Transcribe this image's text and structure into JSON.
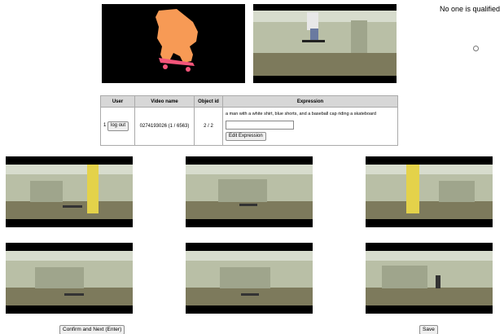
{
  "status": {
    "message": "No one is qualified"
  },
  "table": {
    "headers": [
      "User",
      "Video name",
      "Object id",
      "Expression"
    ],
    "user_index": "1",
    "logout_label": "log out",
    "video_name": "0274193026 (1 / 6563)",
    "object_id": "2 / 2",
    "expression": "a man with a white shirt, blue shorts, and a baseball cap riding a skateboard",
    "expression_input_value": "",
    "edit_expression_label": "Edit Expression"
  },
  "buttons": {
    "confirm_next": "Confirm and Next (Enter)",
    "save": "Save"
  },
  "colors": {
    "mask_fill": "#f79a55",
    "skateboard_fill": "#f5557a",
    "frame_letterbox": "#000000",
    "scene_floor": "#7d7a5c",
    "scene_wall": "#b9bfa6",
    "yellow_pillar": "#e4d24a"
  },
  "frames": [
    {
      "name": "frame-1",
      "has_yellow_pillar": true
    },
    {
      "name": "frame-2",
      "has_yellow_pillar": false
    },
    {
      "name": "frame-3",
      "has_yellow_pillar": true
    },
    {
      "name": "frame-4",
      "has_yellow_pillar": false
    },
    {
      "name": "frame-5",
      "has_yellow_pillar": false
    },
    {
      "name": "frame-6",
      "has_yellow_pillar": false
    }
  ]
}
